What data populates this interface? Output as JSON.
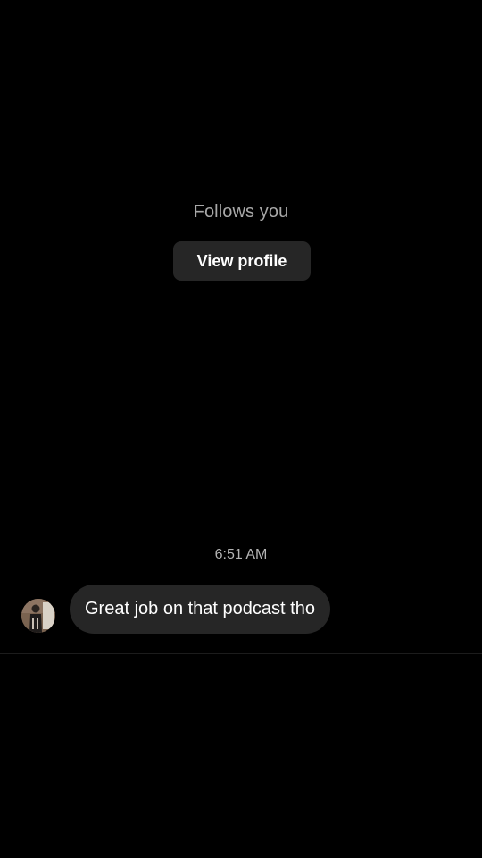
{
  "header": {
    "follows_text": "Follows you",
    "view_profile_label": "View profile"
  },
  "thread": {
    "timestamp": "6:51 AM",
    "messages": [
      {
        "sender": "other",
        "text": "Great job on that podcast tho"
      }
    ]
  },
  "colors": {
    "background": "#000000",
    "bubble": "#262626",
    "button": "#262626",
    "secondary_text": "#a8a8a8",
    "primary_text": "#ffffff"
  },
  "icons": {
    "avatar": "user-avatar-photo"
  }
}
